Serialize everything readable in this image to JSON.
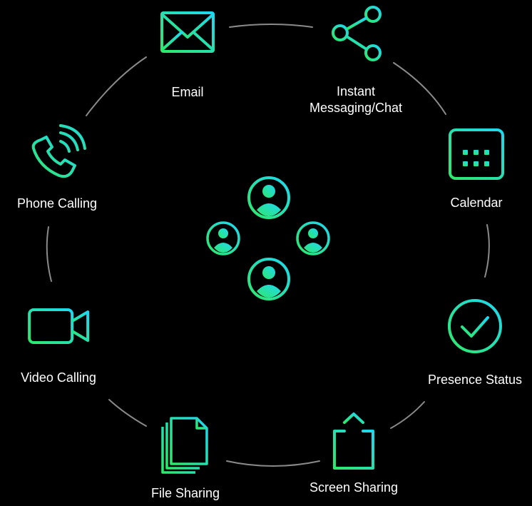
{
  "colors": {
    "background": "#000000",
    "ring": "#8a8a8a",
    "gradient_start": "#2ee86a",
    "gradient_end": "#1ed8f2",
    "text": "#ffffff"
  },
  "center": {
    "icon": "user-group-icon"
  },
  "features": [
    {
      "id": "email",
      "icon": "envelope-icon",
      "label": "Email"
    },
    {
      "id": "instant-messaging",
      "icon": "share-icon",
      "label_lines": [
        "Instant",
        "Messaging/Chat"
      ]
    },
    {
      "id": "calendar",
      "icon": "calendar-icon",
      "label": "Calendar"
    },
    {
      "id": "presence-status",
      "icon": "checkmark-circle-icon",
      "label": "Presence Status"
    },
    {
      "id": "screen-sharing",
      "icon": "upload-share-icon",
      "label": "Screen Sharing"
    },
    {
      "id": "file-sharing",
      "icon": "document-stack-icon",
      "label": "File Sharing"
    },
    {
      "id": "video-calling",
      "icon": "video-camera-icon",
      "label": "Video Calling"
    },
    {
      "id": "phone-calling",
      "icon": "phone-ringing-icon",
      "label": "Phone Calling"
    }
  ]
}
